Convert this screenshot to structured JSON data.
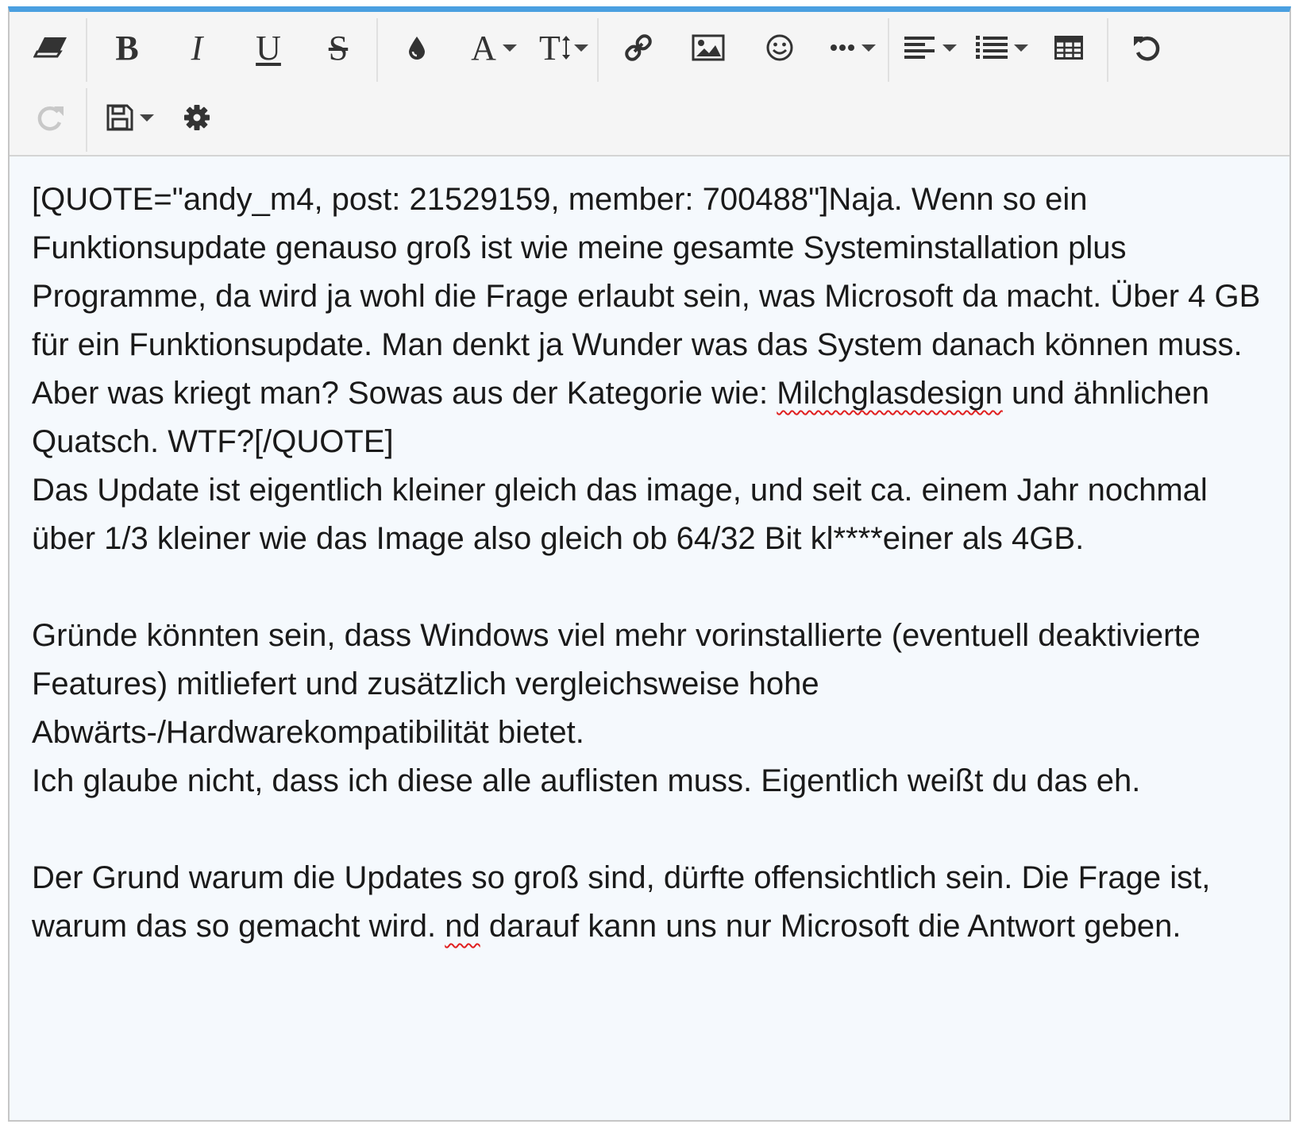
{
  "toolbar": {
    "row1": [
      {
        "id": "eraser",
        "icon": "eraser-icon",
        "tooltip": "Remove formatting"
      },
      {
        "id": "bold",
        "glyph": "B"
      },
      {
        "id": "italic",
        "glyph": "I"
      },
      {
        "id": "underline",
        "glyph": "U"
      },
      {
        "id": "strike",
        "glyph": "S"
      },
      {
        "id": "color",
        "icon": "droplet-icon"
      },
      {
        "id": "font-family",
        "glyph": "A"
      },
      {
        "id": "font-size",
        "glyph": "T"
      },
      {
        "id": "link",
        "icon": "link-icon"
      },
      {
        "id": "image",
        "icon": "image-icon"
      },
      {
        "id": "smilie",
        "icon": "smiley-icon"
      },
      {
        "id": "more",
        "icon": "ellipsis-icon"
      },
      {
        "id": "align",
        "icon": "align-left-icon"
      },
      {
        "id": "list",
        "icon": "list-icon"
      },
      {
        "id": "table",
        "icon": "table-icon"
      },
      {
        "id": "undo",
        "icon": "undo-icon"
      }
    ],
    "row2": [
      {
        "id": "redo",
        "icon": "redo-icon",
        "disabled": true
      },
      {
        "id": "drafts",
        "icon": "save-icon"
      },
      {
        "id": "settings",
        "icon": "gear-icon"
      }
    ]
  },
  "content": {
    "p1": "[QUOTE=\"andy_m4, post: 21529159, member: 700488\"]Naja. Wenn so ein Funktionsupdate genauso groß ist wie meine gesamte Systeminstallation plus Programme, da wird ja wohl die Frage erlaubt sein, was Microsoft da macht. Über 4 GB für ein Funktionsupdate. Man denkt ja Wunder was das System danach können muss.",
    "p2_before": "Aber was kriegt man? Sowas aus der Kategorie wie: ",
    "p2_misspelled": "Milchglasdesign",
    "p2_after": " und ähnlichen Quatsch. WTF?[/QUOTE]",
    "p3": "Das Update ist eigentlich kleiner gleich das image, und seit ca. einem Jahr nochmal über 1/3 kleiner wie das Image also gleich ob 64/32 Bit kl****einer als 4GB.",
    "p4": "Gründe könnten sein, dass Windows viel mehr vorinstallierte (eventuell deaktivierte Features) mitliefert und zusätzlich vergleichsweise hohe Abwärts-/Hardwarekompatibilität bietet.",
    "p5": "Ich glaube nicht, dass ich diese alle auflisten muss. Eigentlich weißt du das eh.",
    "p6_before": "Der Grund warum die Updates so groß sind, dürfte offensichtlich sein. Die Frage ist, warum das so gemacht wird. ",
    "p6_misspelled": "nd",
    "p6_after": " darauf kann uns nur Microsoft die Antwort geben."
  },
  "colors": {
    "accent": "#4a9fe0",
    "toolbar_bg": "#f5f5f5",
    "content_bg": "#f5f9fd",
    "spellcheck": "#e02020"
  }
}
